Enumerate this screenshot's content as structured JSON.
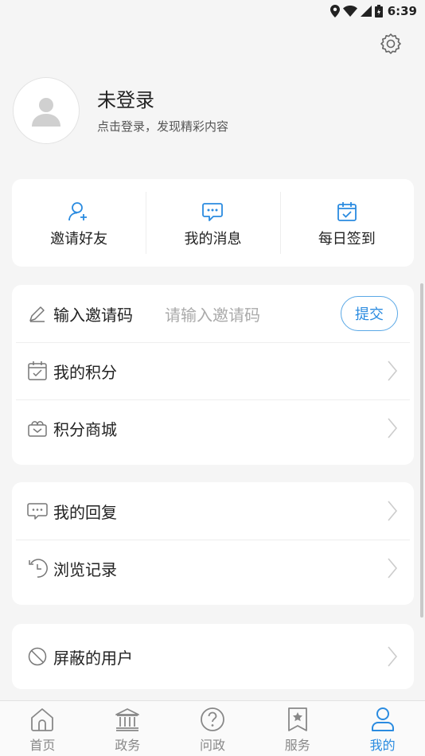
{
  "status": {
    "time": "6:39"
  },
  "profile": {
    "name": "未登录",
    "subtitle": "点击登录，发现精彩内容"
  },
  "quick": [
    {
      "label": "邀请好友",
      "icon": "add-user-icon"
    },
    {
      "label": "我的消息",
      "icon": "message-icon"
    },
    {
      "label": "每日签到",
      "icon": "calendar-check-icon"
    }
  ],
  "invite": {
    "label": "输入邀请码",
    "placeholder": "请输入邀请码",
    "submit": "提交"
  },
  "menu": {
    "points": "我的积分",
    "mall": "积分商城",
    "replies": "我的回复",
    "history": "浏览记录",
    "blocked": "屏蔽的用户"
  },
  "tabs": [
    {
      "label": "首页",
      "icon": "home-icon"
    },
    {
      "label": "政务",
      "icon": "government-icon"
    },
    {
      "label": "问政",
      "icon": "question-icon"
    },
    {
      "label": "服务",
      "icon": "star-bookmark-icon"
    },
    {
      "label": "我的",
      "icon": "user-icon",
      "active": true
    }
  ],
  "colors": {
    "accent": "#2a8be0",
    "background": "#f5f5f5"
  }
}
